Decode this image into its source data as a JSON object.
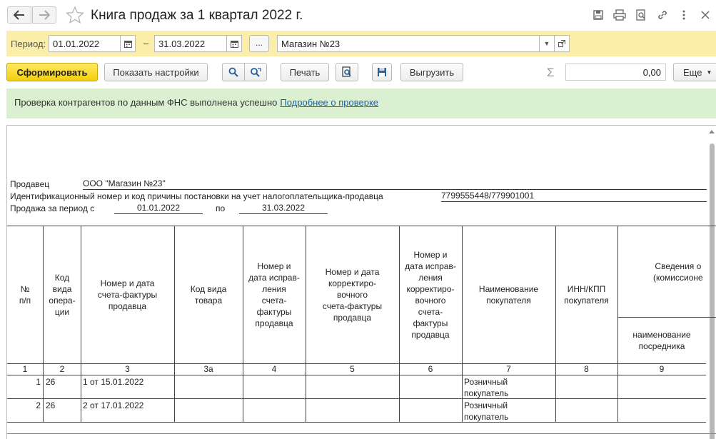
{
  "window": {
    "title": "Книга продаж за 1 квартал 2022 г."
  },
  "period": {
    "label": "Период:",
    "from": "01.01.2022",
    "dash": "–",
    "to": "31.03.2022",
    "dots": "...",
    "organization": "Магазин №23"
  },
  "toolbar": {
    "generate": "Сформировать",
    "show_settings": "Показать настройки",
    "print": "Печать",
    "export": "Выгрузить",
    "sum_value": "0,00",
    "more": "Еще"
  },
  "info": {
    "text": "Проверка контрагентов по данным ФНС выполнена успешно",
    "link": "Подробнее о проверке"
  },
  "report": {
    "seller_label": "Продавец",
    "seller_value": "ООО \"Магазин №23\"",
    "inn_label": "Идентификационный номер и код причины постановки на учет налогоплательщика-продавца",
    "inn_value": "7799555448/779901001",
    "period_label": "Продажа за период с",
    "period_from": "01.01.2022",
    "period_to_label": "по",
    "period_to": "31.03.2022",
    "columns": [
      "№\nп/п",
      "Код\nвида\nопера-\nции",
      "Номер и дата\nсчета-фактуры\nпродавца",
      "Код вида\nтовара",
      "Номер и\nдата исправ-\nления\nсчета-\nфактуры\nпродавца",
      "Номер и дата\nкорректиро-\nвочного\nсчета-фактуры\nпродавца",
      "Номер и\nдата исправ-\nления\nкорректиро-\nвочного\nсчета-\nфактуры\nпродавца",
      "Наименование\nпокупателя",
      "ИНН/КПП\nпокупателя",
      "Сведения о\n(комиссионе"
    ],
    "subcolumn": "наименование\nпосредника",
    "col_numbers": [
      "1",
      "2",
      "3",
      "3а",
      "4",
      "5",
      "6",
      "7",
      "8",
      "9"
    ],
    "rows": [
      {
        "n": "1",
        "op": "26",
        "invoice": "1 от 15.01.2022",
        "buyer": "Розничный\nпокупатель"
      },
      {
        "n": "2",
        "op": "26",
        "invoice": "2 от 17.01.2022",
        "buyer": "Розничный\nпокупатель"
      }
    ]
  },
  "colors": {
    "period_bar": "#fbeeab",
    "info_bar": "#dbefd1",
    "primary_button": "#f4ce0b",
    "link": "#1a5fa8"
  }
}
